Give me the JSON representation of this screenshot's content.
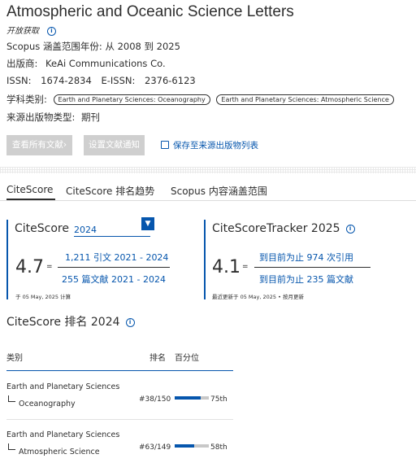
{
  "source": {
    "title": "Atmospheric and Oceanic Science Letters",
    "open_access": "开放获取",
    "coverage_label": "Scopus 涵盖范围年份:",
    "coverage_value": "从 2008 到 2025",
    "publisher_label": "出版商:",
    "publisher_value": "KeAi Communications Co.",
    "issn_label": "ISSN:",
    "issn_value": "1674-2834",
    "eissn_label": "E-ISSN:",
    "eissn_value": "2376-6123",
    "subject_label": "学科类别:",
    "subject_tags": [
      "Earth and Planetary Sciences: Oceanography",
      "Earth and Planetary Sciences: Atmospheric Science"
    ],
    "type_label": "来源出版物类型:",
    "type_value": "期刊"
  },
  "actions": {
    "view_all_docs": "查看所有文献",
    "set_alert": "设置文献通知",
    "save_list": "保存至来源出版物列表"
  },
  "tabs": [
    "CiteScore",
    "CiteScore 排名趋势",
    "Scopus 内容涵盖范围"
  ],
  "citescore": {
    "label": "CiteScore",
    "year": "2024",
    "value": "4.7",
    "eq": "=",
    "citations": "1,211 引文 2021 - 2024",
    "documents": "255 篇文献 2021 - 2024",
    "calc_note": "于 05 May, 2025 计算"
  },
  "tracker": {
    "label": "CiteScoreTracker 2025",
    "value": "4.1",
    "eq": "=",
    "citations": "到目前为止 974 次引用",
    "documents": "到目前为止 235 篇文献",
    "update_note": "最近更新于 05 May, 2025 • 按月更新"
  },
  "ranking": {
    "title": "CiteScore 排名 2024",
    "col_category": "类别",
    "col_rank": "排名",
    "col_percentile": "百分位",
    "rows": [
      {
        "category": "Earth and Planetary Sciences",
        "sub": "Oceanography",
        "rank": "#38/150",
        "percentile": "75th",
        "pct_value": 75
      },
      {
        "category": "Earth and Planetary Sciences",
        "sub": "Atmospheric Science",
        "rank": "#63/149",
        "percentile": "58th",
        "pct_value": 58
      }
    ]
  },
  "colors": {
    "accent": "#0656ad",
    "button_disabled": "#cfcfcf",
    "text": "#2e2e2e"
  }
}
